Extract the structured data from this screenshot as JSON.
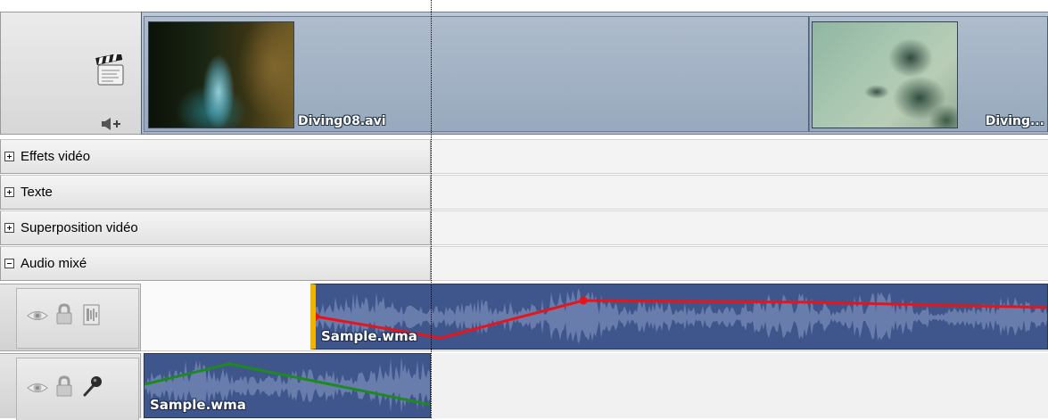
{
  "video_track": {
    "clips": [
      {
        "label": "Diving08.avi"
      },
      {
        "label": "Diving..."
      }
    ],
    "icons": [
      "clapperboard-icon",
      "speaker-add-icon"
    ]
  },
  "rows": [
    {
      "label": "Effets vidéo",
      "state": "collapsed"
    },
    {
      "label": "Texte",
      "state": "collapsed"
    },
    {
      "label": "Superposition vidéo",
      "state": "collapsed"
    },
    {
      "label": "Audio mixé",
      "state": "expanded"
    }
  ],
  "audio_tracks": [
    {
      "clip_label": "Sample.wma",
      "icons": [
        "eye-icon",
        "lock-icon",
        "audio-file-icon"
      ],
      "envelope_color": "#e8141a"
    },
    {
      "clip_label": "Sample.wma",
      "icons": [
        "eye-icon",
        "lock-icon",
        "microphone-icon"
      ],
      "envelope_color": "#1e8a1e"
    }
  ],
  "colors": {
    "video_track": "#a9b7c8",
    "audio_clip": "#3f568d",
    "clip_start_marker": "#f0b400"
  }
}
